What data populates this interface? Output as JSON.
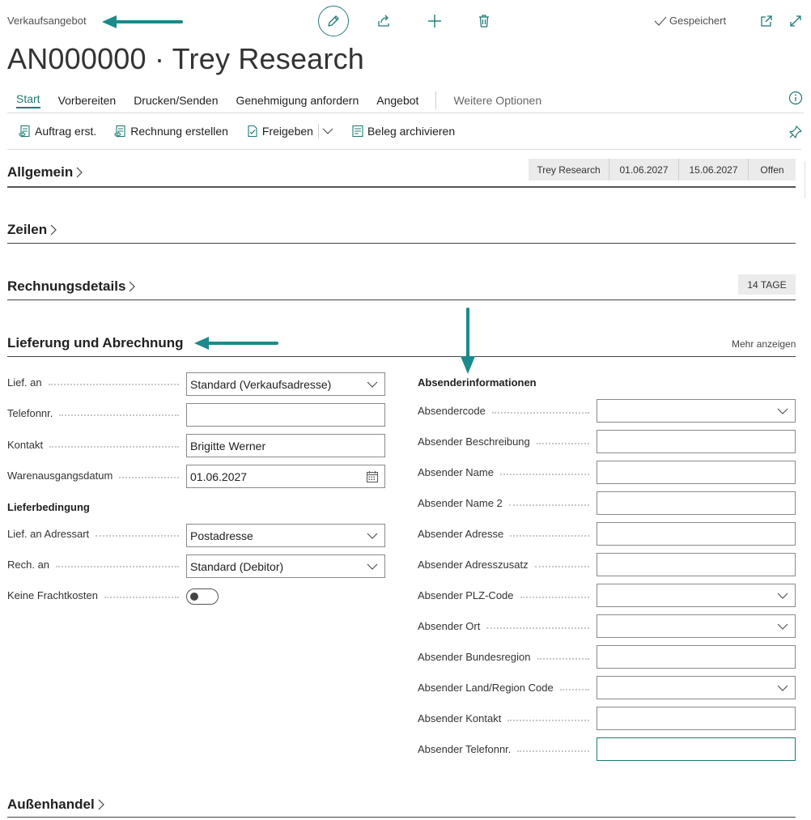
{
  "header": {
    "page_type": "Verkaufsangebot",
    "title": "AN000000 · Trey Research",
    "saved_label": "Gespeichert",
    "icons": [
      "edit-icon",
      "share-icon",
      "add-icon",
      "delete-icon",
      "open-new-window-icon",
      "expand-icon"
    ]
  },
  "tabs": {
    "items": [
      "Start",
      "Vorbereiten",
      "Drucken/Senden",
      "Genehmigung anfordern",
      "Angebot"
    ],
    "more": "Weitere Optionen",
    "active": "Start"
  },
  "actions": {
    "items": [
      "Auftrag erst.",
      "Rechnung erstellen",
      "Freigeben",
      "Beleg archivieren"
    ]
  },
  "sections": {
    "allgemein": {
      "title": "Allgemein",
      "badges": [
        "Trey Research",
        "01.06.2027",
        "15.06.2027",
        "Offen"
      ]
    },
    "zeilen": {
      "title": "Zeilen"
    },
    "rechnungsdetails": {
      "title": "Rechnungsdetails",
      "badge": "14 TAGE"
    },
    "lieferung": {
      "title": "Lieferung und Abrechnung",
      "more_link": "Mehr anzeigen",
      "left_fields": [
        {
          "label": "Lief. an",
          "value": "Standard (Verkaufsadresse)"
        },
        {
          "label": "Telefonnr.",
          "value": ""
        },
        {
          "label": "Kontakt",
          "value": "Brigitte Werner"
        },
        {
          "label": "Warenausgangsdatum",
          "value": "01.06.2027"
        }
      ],
      "lieferbedingung_title": "Lieferbedingung",
      "lieferbedingung_fields": [
        {
          "label": "Lief. an Adressart",
          "value": "Postadresse"
        },
        {
          "label": "Rech. an",
          "value": "Standard (Debitor)"
        },
        {
          "label": "Keine Frachtkosten",
          "value": ""
        }
      ],
      "absender_title": "Absenderinformationen",
      "absender_fields": [
        {
          "label": "Absendercode",
          "value": ""
        },
        {
          "label": "Absender Beschreibung",
          "value": ""
        },
        {
          "label": "Absender Name",
          "value": ""
        },
        {
          "label": "Absender Name 2",
          "value": ""
        },
        {
          "label": "Absender Adresse",
          "value": ""
        },
        {
          "label": "Absender Adresszusatz",
          "value": ""
        },
        {
          "label": "Absender PLZ-Code",
          "value": ""
        },
        {
          "label": "Absender Ort",
          "value": ""
        },
        {
          "label": "Absender Bundesregion",
          "value": ""
        },
        {
          "label": "Absender Land/Region Code",
          "value": ""
        },
        {
          "label": "Absender Kontakt",
          "value": ""
        },
        {
          "label": "Absender Telefonnr.",
          "value": ""
        }
      ]
    },
    "aussenhandel": {
      "title": "Außenhandel"
    }
  },
  "colors": {
    "accent": "#1f7a74",
    "arrow": "#1b8a8c"
  }
}
